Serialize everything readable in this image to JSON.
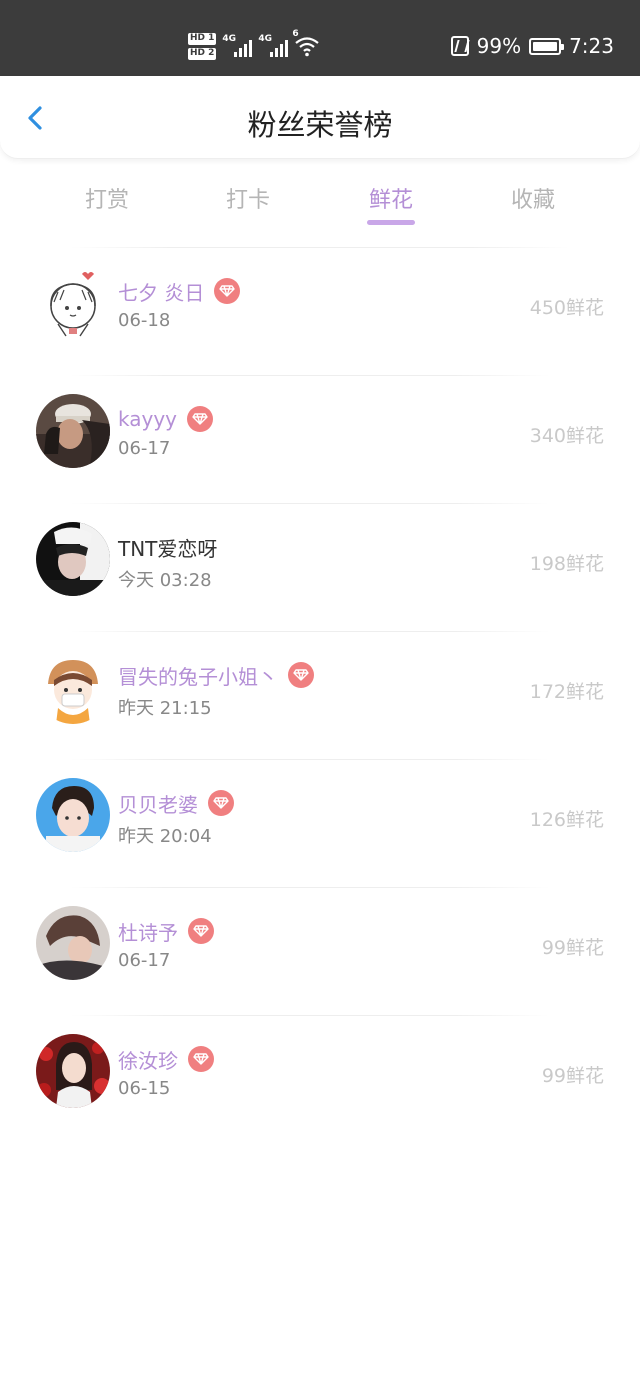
{
  "status_bar": {
    "sim1": "HD 1",
    "sim2": "HD 2",
    "net1": "4G",
    "net2": "4G",
    "wifi_tag": "6",
    "battery": "99%",
    "time": "7:23"
  },
  "header": {
    "title": "粉丝荣誉榜",
    "back_icon": "chevron-left-icon"
  },
  "tabs": [
    {
      "label": "打赏",
      "active": false
    },
    {
      "label": "打卡",
      "active": false
    },
    {
      "label": "鲜花",
      "active": true
    },
    {
      "label": "收藏",
      "active": false
    }
  ],
  "colors": {
    "accent": "#b48fd6",
    "vip_badge": "#f07f80",
    "status_bar_bg": "#3c3c3c",
    "back_icon": "#2f8fe0"
  },
  "fans": [
    {
      "name": "七夕 炎日",
      "vip": true,
      "time": "06-18",
      "amount": "450鲜花",
      "avatar": "cartoon-girl-avatar"
    },
    {
      "name": "kayyy",
      "vip": true,
      "time": "06-17",
      "amount": "340鲜花",
      "avatar": "photo-avatar"
    },
    {
      "name": "TNT爱恋呀",
      "vip": false,
      "time": "今天 03:28",
      "amount": "198鲜花",
      "avatar": "photo-avatar"
    },
    {
      "name": "冒失的兔子小姐丶",
      "vip": true,
      "time": "昨天 21:15",
      "amount": "172鲜花",
      "avatar": "cartoon-avatar"
    },
    {
      "name": "贝贝老婆",
      "vip": true,
      "time": "昨天 20:04",
      "amount": "126鲜花",
      "avatar": "photo-avatar"
    },
    {
      "name": "杜诗予",
      "vip": true,
      "time": "06-17",
      "amount": "99鲜花",
      "avatar": "photo-avatar"
    },
    {
      "name": "徐汝珍",
      "vip": true,
      "time": "06-15",
      "amount": "99鲜花",
      "avatar": "photo-avatar"
    }
  ]
}
